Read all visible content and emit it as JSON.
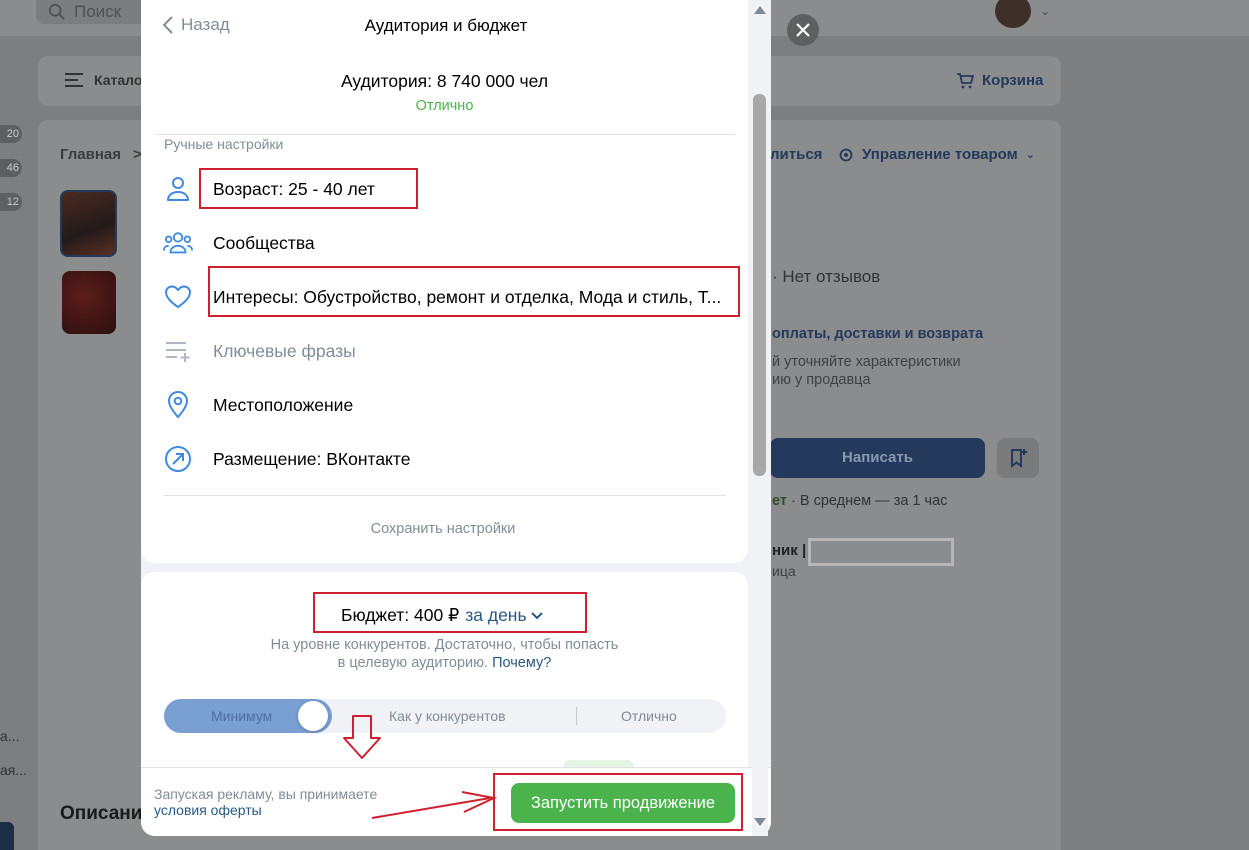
{
  "background": {
    "search_placeholder": "Поиск",
    "catalog_label": "Каталог",
    "cart_label": "Корзина",
    "breadcrumb_home": "Главная",
    "breadcrumb_sep": ">",
    "badges": [
      "20",
      "46",
      "12"
    ],
    "share_label": "литься",
    "manage_label": "Управление товаром",
    "reviews_label": "· Нет отзывов",
    "pay_label": "оплаты, доставки и возврата",
    "clarify_line1": "й уточняйте характеристики",
    "clarify_line2": "ию у продавца",
    "write_button": "Написать",
    "response_status": "ет",
    "response_time": " · В среднем — за 1 час",
    "seller_label": "ник |",
    "seller_sub": "ица",
    "left_text_a": "а...",
    "left_text_b": "ая...",
    "description_heading": "Описание"
  },
  "modal": {
    "back_label": "Назад",
    "title": "Аудитория и бюджет",
    "audience": "Аудитория: 8 740 000 чел",
    "audience_rating": "Отлично",
    "manual_settings_label": "Ручные настройки",
    "settings": [
      {
        "icon": "person-icon",
        "label": "Возраст: 25 - 40 лет"
      },
      {
        "icon": "group-icon",
        "label": "Сообщества"
      },
      {
        "icon": "heart-icon",
        "label": "Интересы: Обустройство, ремонт и отделка, Мода и стиль, Т..."
      },
      {
        "icon": "list-add-icon",
        "label": "Ключевые фразы"
      },
      {
        "icon": "location-pin-icon",
        "label": "Местоположение"
      },
      {
        "icon": "arrow-circle-icon",
        "label": "Размещение: ВКонтакте"
      }
    ],
    "save_settings": "Сохранить настройки",
    "budget_label": "Бюджет: 400 ₽",
    "budget_period": "за день",
    "budget_note_line1": "На уровне конкурентов. Достаточно, чтобы попасть",
    "budget_note_line2": "в целевую аудиторию.",
    "budget_why": "Почему?",
    "slider": {
      "level_min": "Минимум",
      "level_mid": "Как у конкурентов",
      "level_max": "Отлично",
      "selected": "Минимум"
    },
    "footer_text": "Запуская рекламу, вы принимаете",
    "footer_offer": "условия оферты",
    "launch_button": "Запустить продвижение"
  },
  "colors": {
    "accent_green": "#4bb34b",
    "link_blue": "#2a5885",
    "annotation_red": "#d0202f",
    "annotation_arrow": "#d0202f"
  }
}
